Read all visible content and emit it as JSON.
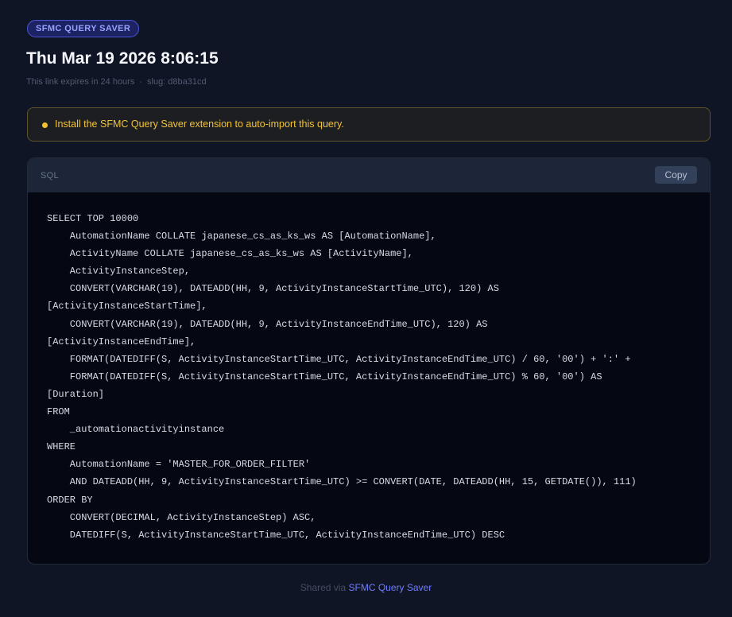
{
  "header": {
    "badge": "SFMC QUERY SAVER",
    "title": "Thu Mar 19 2026 8:06:15",
    "expires": "This link expires in 24 hours",
    "separator": "·",
    "slug": "slug: d8ba31cd"
  },
  "notice": {
    "message": "Install the SFMC Query Saver extension to auto-import this query."
  },
  "code": {
    "language": "SQL",
    "copy_label": "Copy",
    "lines": [
      "SELECT TOP 10000",
      "    AutomationName COLLATE japanese_cs_as_ks_ws AS [AutomationName],",
      "    ActivityName COLLATE japanese_cs_as_ks_ws AS [ActivityName],",
      "    ActivityInstanceStep,",
      "    CONVERT(VARCHAR(19), DATEADD(HH, 9, ActivityInstanceStartTime_UTC), 120) AS",
      "[ActivityInstanceStartTime],",
      "    CONVERT(VARCHAR(19), DATEADD(HH, 9, ActivityInstanceEndTime_UTC), 120) AS",
      "[ActivityInstanceEndTime],",
      "    FORMAT(DATEDIFF(S, ActivityInstanceStartTime_UTC, ActivityInstanceEndTime_UTC) / 60, '00') + ':' +",
      "    FORMAT(DATEDIFF(S, ActivityInstanceStartTime_UTC, ActivityInstanceEndTime_UTC) % 60, '00') AS",
      "[Duration]",
      "FROM",
      "    _automationactivityinstance",
      "WHERE",
      "    AutomationName = 'MASTER_FOR_ORDER_FILTER'",
      "    AND DATEADD(HH, 9, ActivityInstanceStartTime_UTC) >= CONVERT(DATE, DATEADD(HH, 15, GETDATE()), 111)",
      "ORDER BY",
      "    CONVERT(DECIMAL, ActivityInstanceStep) ASC,",
      "    DATEDIFF(S, ActivityInstanceStartTime_UTC, ActivityInstanceEndTime_UTC) DESC"
    ]
  },
  "footer": {
    "prefix": "Shared via",
    "link_label": "SFMC Query Saver"
  },
  "colors": {
    "background": "#0f1524",
    "accent": "#6f7dff",
    "warning": "#f1c33a"
  }
}
